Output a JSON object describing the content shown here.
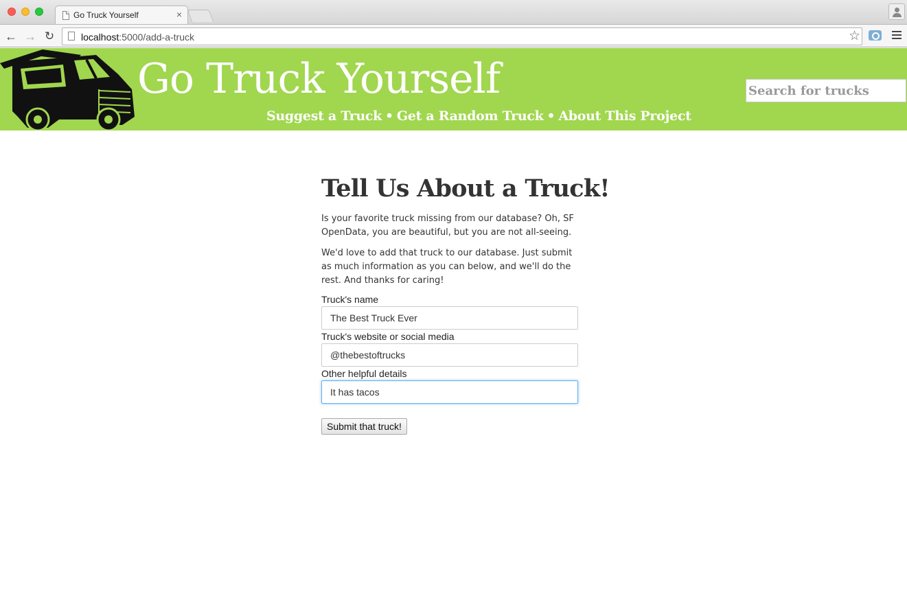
{
  "browser": {
    "tab_title": "Go Truck Yourself",
    "tab_close": "×",
    "url_host": "localhost",
    "url_path": ":5000/add-a-truck",
    "icons": {
      "back": "back-arrow-icon",
      "forward": "forward-arrow-icon",
      "reload": "reload-icon",
      "star": "bookmark-star-icon",
      "camera": "camera-icon",
      "menu": "hamburger-menu-icon",
      "profile": "profile-icon"
    }
  },
  "header": {
    "title": "Go Truck Yourself",
    "nav": {
      "suggest": "Suggest a Truck",
      "random": "Get a Random Truck",
      "about": "About This Project",
      "separator": "•"
    },
    "search_placeholder": "Search for trucks",
    "background_color": "#a1d64f"
  },
  "main": {
    "title": "Tell Us About a Truck!",
    "paragraph1": "Is your favorite truck missing from our database? Oh, SF OpenData, you are beautiful, but you are not all-seeing.",
    "paragraph2": "We'd love to add that truck to our database. Just submit as much information as you can below, and we'll do the rest. And thanks for caring!",
    "form": {
      "name_label": "Truck's name",
      "name_value": "The Best Truck Ever",
      "website_label": "Truck's website or social media",
      "website_value": "@thebestoftrucks",
      "details_label": "Other helpful details",
      "details_value": "It has tacos",
      "submit_label": "Submit that truck!"
    }
  }
}
